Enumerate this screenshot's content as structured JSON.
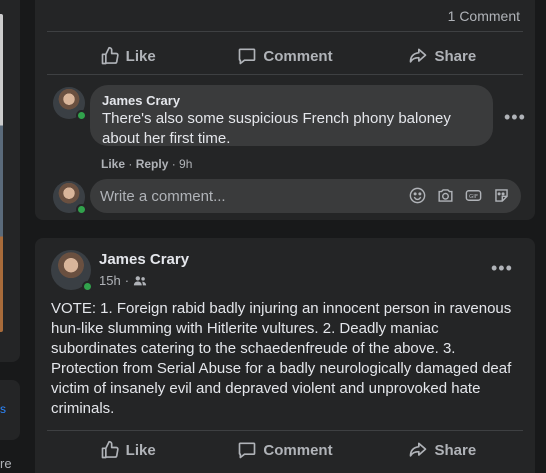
{
  "post1": {
    "comment_count": "1 Comment",
    "actions": {
      "like": "Like",
      "comment": "Comment",
      "share": "Share"
    },
    "comment": {
      "author": "James Crary",
      "text": "There's also some suspicious French phony baloney about her first time.",
      "like": "Like",
      "sep1": " · ",
      "reply": "Reply",
      "time": " · 9h"
    },
    "write_placeholder": "Write a comment..."
  },
  "post2": {
    "author": "James Crary",
    "time": "15h",
    "meta_sep": "·",
    "body": "VOTE:  1. Foreign rabid badly injuring an innocent person in ravenous hun-like slumming with Hitlerite vultures.  2. Deadly maniac subordinates catering to the schaedenfreude of the above.  3. Protection from Serial Abuse for a badly neurologically damaged deaf victim of insanely evil and depraved violent and unprovoked hate criminals.",
    "actions": {
      "like": "Like",
      "comment": "Comment",
      "share": "Share"
    }
  },
  "left_edge": {
    "text": "re"
  },
  "colors": {
    "online": "#31a24c",
    "link": "#2d88ff",
    "card": "#242526",
    "bg": "#18191a"
  }
}
